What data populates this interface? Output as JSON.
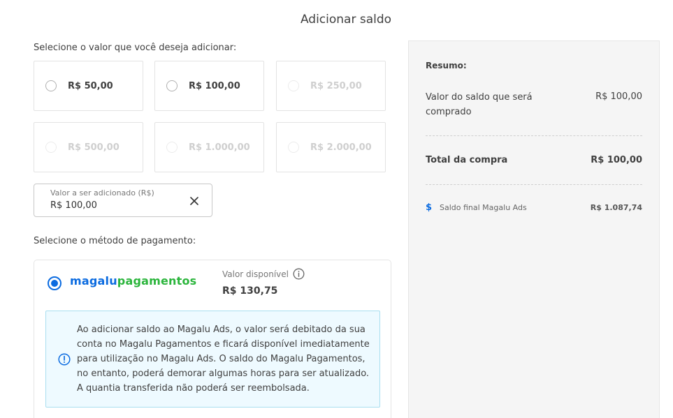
{
  "page": {
    "title": "Adicionar saldo"
  },
  "value_section": {
    "label": "Selecione o valor que você deseja adicionar:",
    "options": [
      {
        "label": "R$ 50,00",
        "enabled": true
      },
      {
        "label": "R$ 100,00",
        "enabled": true
      },
      {
        "label": "R$ 250,00",
        "enabled": false
      },
      {
        "label": "R$ 500,00",
        "enabled": false
      },
      {
        "label": "R$ 1.000,00",
        "enabled": false
      },
      {
        "label": "R$ 2.000,00",
        "enabled": false
      }
    ]
  },
  "amount_field": {
    "label": "Valor a ser adicionado (R$)",
    "value": "R$ 100,00"
  },
  "payment_section": {
    "label": "Selecione o método de pagamento:",
    "method": {
      "logo_primary": "magalu",
      "logo_secondary": "pagamentos",
      "available_label": "Valor disponível",
      "available_value": "R$ 130,75",
      "selected": true
    },
    "notice": "Ao adicionar saldo ao Magalu Ads, o valor será debitado da sua conta no Magalu Pagamentos e ficará disponível imediatamente para utilização no Magalu Ads. O saldo do Magalu Pagamentos, no entanto, poderá demorar algumas horas para ser atualizado. A quantia transferida não poderá ser reembolsada."
  },
  "summary": {
    "title": "Resumo:",
    "balance_label": "Valor do saldo que será comprado",
    "balance_value": "R$ 100,00",
    "total_label": "Total da compra",
    "total_value": "R$ 100,00",
    "final_label": "Saldo final Magalu Ads",
    "final_value": "R$ 1.087,74",
    "final_icon": "$"
  },
  "colors": {
    "accent": "#0b6be0",
    "brand_green": "#2bb53c",
    "notice_bg": "#eefaff",
    "notice_border": "#a9dff0"
  }
}
